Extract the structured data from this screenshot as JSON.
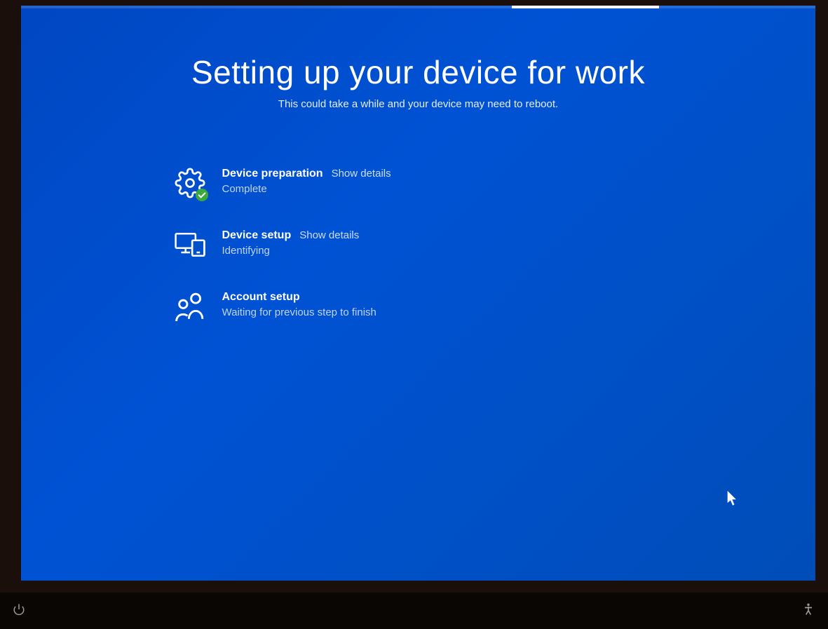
{
  "header": {
    "title": "Setting up your device for work",
    "subtitle": "This could take a while and your device may need to reboot."
  },
  "steps": [
    {
      "title": "Device preparation",
      "show_details": "Show details",
      "status": "Complete",
      "icon": "gear-icon",
      "complete": true
    },
    {
      "title": "Device setup",
      "show_details": "Show details",
      "status": "Identifying",
      "icon": "devices-icon",
      "complete": false
    },
    {
      "title": "Account setup",
      "show_details": "",
      "status": "Waiting for previous step to finish",
      "icon": "people-icon",
      "complete": false
    }
  ]
}
